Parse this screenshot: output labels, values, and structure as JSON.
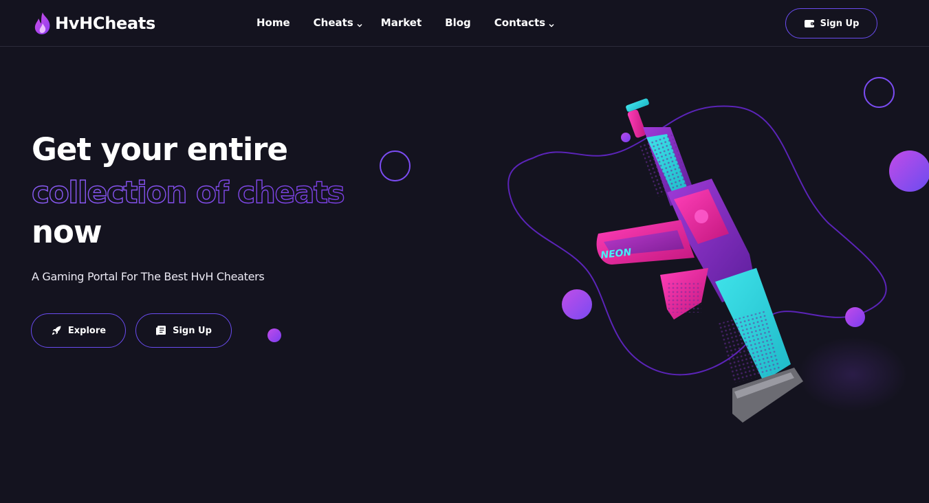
{
  "brand": {
    "name": "HvHCheats",
    "logo_icon": "flame-icon",
    "accent": "#7b4cf2",
    "accent_pink": "#c24be8",
    "background": "#14131f"
  },
  "nav": {
    "items": [
      {
        "label": "Home",
        "has_dropdown": false
      },
      {
        "label": "Cheats",
        "has_dropdown": true
      },
      {
        "label": "Market",
        "has_dropdown": false
      },
      {
        "label": "Blog",
        "has_dropdown": false
      },
      {
        "label": "Contacts",
        "has_dropdown": true
      }
    ]
  },
  "header": {
    "signup_label": "Sign Up",
    "signup_icon": "wallet-icon"
  },
  "hero": {
    "title_line1": "Get your entire",
    "title_line2": "collection of cheats",
    "title_line3": "now",
    "subtitle": "A Gaming Portal For The Best HvH Cheaters",
    "explore_label": "Explore",
    "explore_icon": "rocket-icon",
    "signup_label": "Sign Up",
    "signup_icon": "document-icon",
    "weapon_skin_text": "NEON"
  }
}
